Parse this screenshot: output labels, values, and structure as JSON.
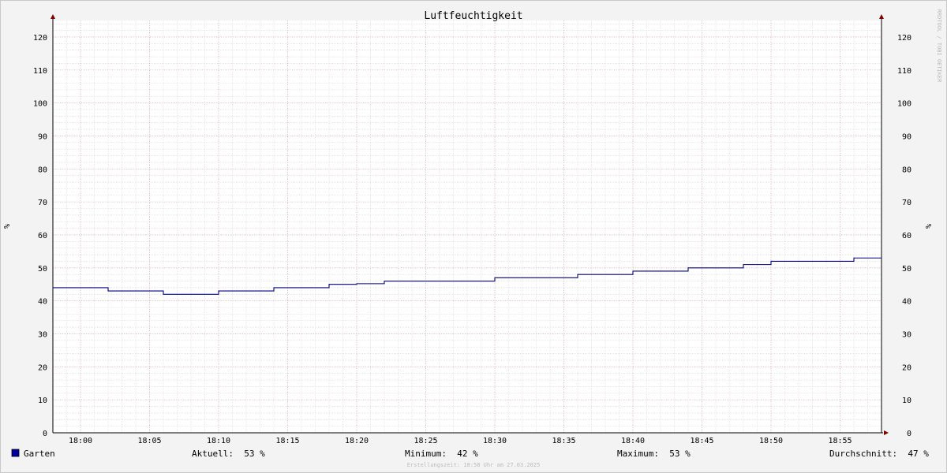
{
  "chart_data": {
    "type": "line",
    "title": "Luftfeuchtigkeit",
    "ylabel": "%",
    "ylabel_right": "%",
    "ylim": [
      0,
      125
    ],
    "yticks": [
      0,
      10,
      20,
      30,
      40,
      50,
      60,
      70,
      80,
      90,
      100,
      110,
      120
    ],
    "xlim": [
      "17:58",
      "18:58"
    ],
    "xticks": [
      "18:00",
      "18:05",
      "18:10",
      "18:15",
      "18:20",
      "18:25",
      "18:30",
      "18:35",
      "18:40",
      "18:45",
      "18:50",
      "18:55"
    ],
    "grid": true,
    "watermark": "RRDTOOL / TOBI OETIKER",
    "colors": {
      "series": "#000080",
      "major_grid": "#e8b4bc",
      "minor_grid": "#d8d8d8",
      "background": "#f3f3f3",
      "axis": "#800000"
    },
    "series": [
      {
        "name": "Garten",
        "step": true,
        "points": [
          {
            "x": "17:58",
            "y": 44
          },
          {
            "x": "18:02",
            "y": 43
          },
          {
            "x": "18:06",
            "y": 42
          },
          {
            "x": "18:10",
            "y": 43
          },
          {
            "x": "18:14",
            "y": 44
          },
          {
            "x": "18:18",
            "y": 45
          },
          {
            "x": "18:20",
            "y": 45.2
          },
          {
            "x": "18:22",
            "y": 46
          },
          {
            "x": "18:30",
            "y": 47
          },
          {
            "x": "18:36",
            "y": 48
          },
          {
            "x": "18:40",
            "y": 49
          },
          {
            "x": "18:44",
            "y": 50
          },
          {
            "x": "18:48",
            "y": 51
          },
          {
            "x": "18:50",
            "y": 52
          },
          {
            "x": "18:56",
            "y": 53
          },
          {
            "x": "18:58",
            "y": 53
          }
        ]
      }
    ]
  },
  "legend": {
    "series_name": "Garten",
    "current": "Aktuell:  53 %",
    "minimum": "Minimum:  42 %",
    "maximum": "Maximum:  53 %",
    "average": "Durchschnitt:  47 %"
  },
  "footer": "Erstellungszeit: 18:58 Uhr am 27.03.2025"
}
